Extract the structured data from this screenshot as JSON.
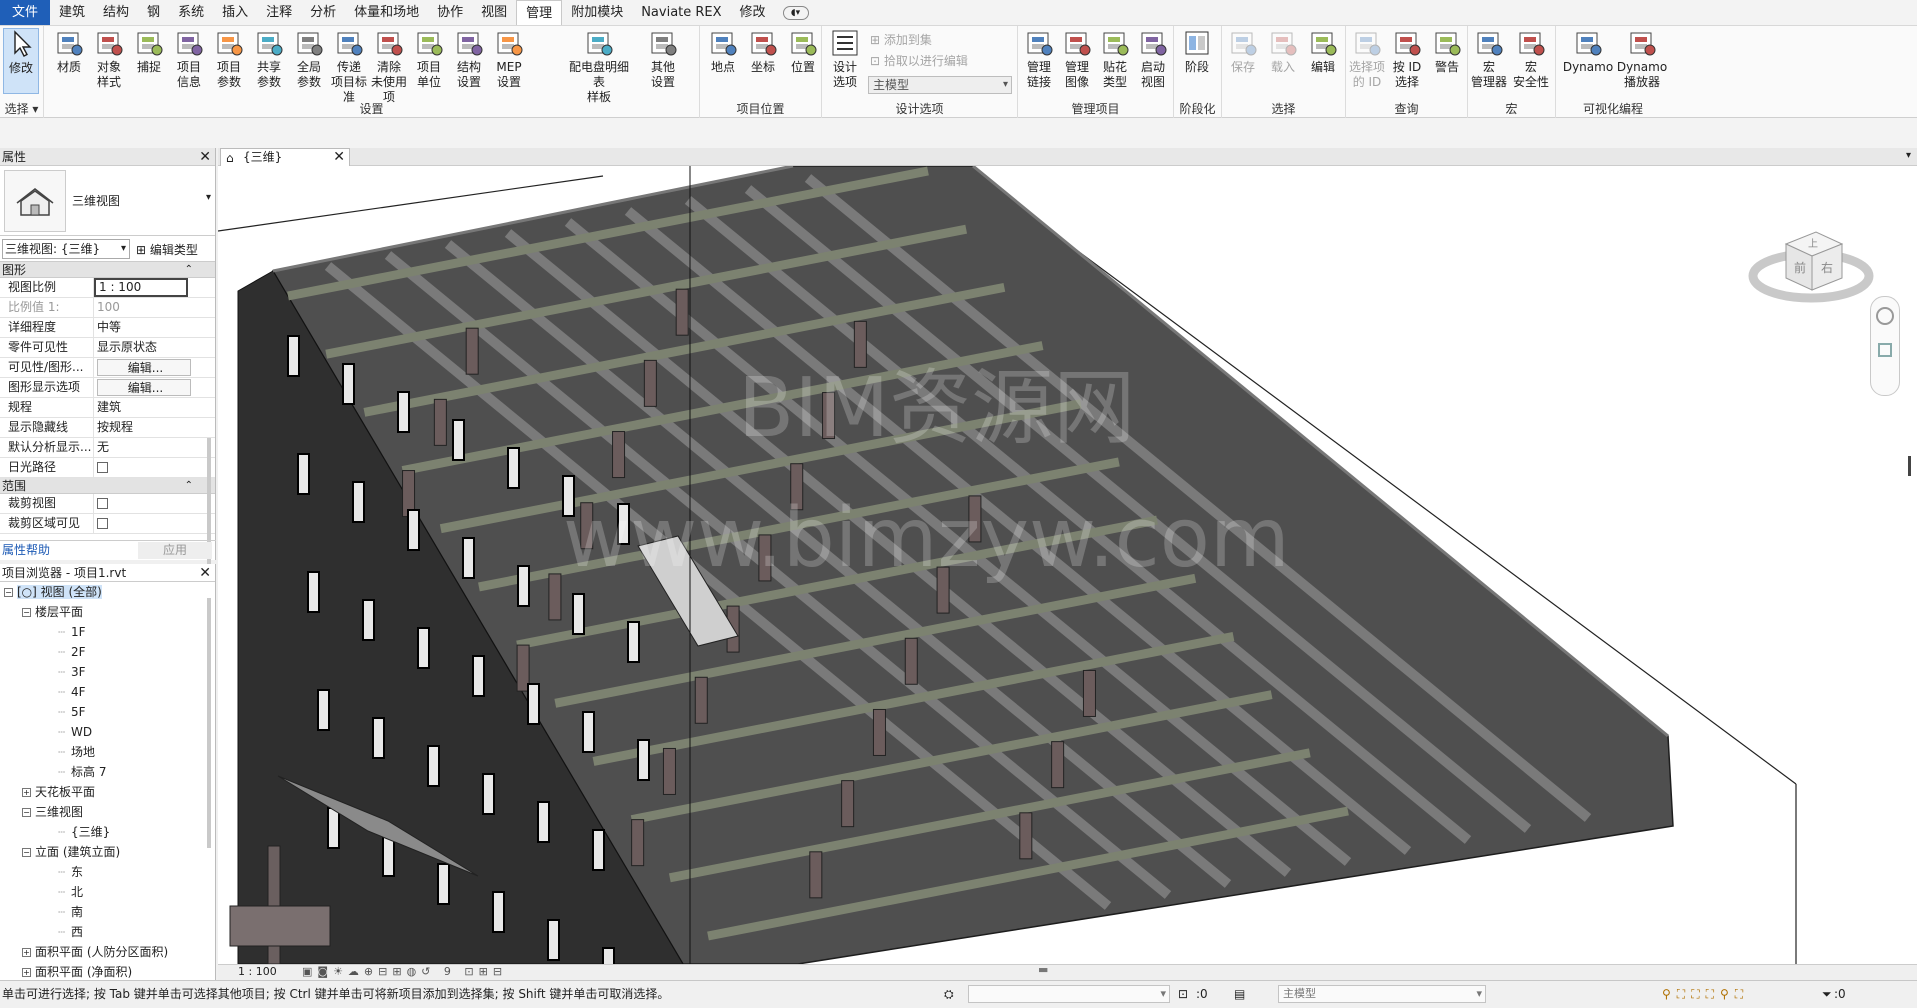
{
  "menu": {
    "tabs": [
      "文件",
      "建筑",
      "结构",
      "钢",
      "系统",
      "插入",
      "注释",
      "分析",
      "体量和场地",
      "协作",
      "视图",
      "管理",
      "附加模块",
      "Naviate REX",
      "修改"
    ],
    "active": "管理"
  },
  "ribbon": {
    "select": {
      "modify": "修改",
      "select": "选择 ▾"
    },
    "settings": {
      "title": "设置",
      "buttons": [
        {
          "l1": "材质",
          "l2": ""
        },
        {
          "l1": "对象",
          "l2": "样式"
        },
        {
          "l1": "捕捉",
          "l2": ""
        },
        {
          "l1": "项目",
          "l2": "信息"
        },
        {
          "l1": "项目",
          "l2": "参数"
        },
        {
          "l1": "共享",
          "l2": "参数"
        },
        {
          "l1": "全局",
          "l2": "参数"
        },
        {
          "l1": "传递",
          "l2": "项目标准"
        },
        {
          "l1": "清除",
          "l2": "未使用项"
        },
        {
          "l1": "项目",
          "l2": "单位"
        },
        {
          "l1": "结构",
          "l2": "设置"
        },
        {
          "l1": "MEP",
          "l2": "设置"
        },
        {
          "l1": "配电盘明细表",
          "l2": "样板"
        },
        {
          "l1": "其他",
          "l2": "设置"
        }
      ]
    },
    "location": {
      "title": "项目位置",
      "buttons": [
        {
          "l1": "地点",
          "l2": ""
        },
        {
          "l1": "坐标",
          "l2": ""
        },
        {
          "l1": "位置",
          "l2": ""
        }
      ]
    },
    "design_options": {
      "title": "设计选项",
      "button": {
        "l1": "设计",
        "l2": "选项"
      },
      "add_to_set": "添加到集",
      "pick_to_edit": "拾取以进行编辑",
      "main_model": "主模型"
    },
    "manage_project": {
      "title": "管理项目",
      "buttons": [
        {
          "l1": "管理",
          "l2": "链接"
        },
        {
          "l1": "管理",
          "l2": "图像"
        },
        {
          "l1": "贴花",
          "l2": "类型"
        },
        {
          "l1": "启动",
          "l2": "视图"
        }
      ]
    },
    "phasing": {
      "title": "阶段化",
      "button": "阶段"
    },
    "selection": {
      "title": "选择",
      "buttons": [
        "保存",
        "载入",
        "编辑"
      ]
    },
    "inquiry": {
      "title": "查询",
      "buttons": [
        {
          "l1": "选择项",
          "l2": "的 ID"
        },
        {
          "l1": "按 ID",
          "l2": "选择"
        },
        {
          "l1": "警告",
          "l2": ""
        }
      ]
    },
    "macros": {
      "title": "宏",
      "buttons": [
        {
          "l1": "宏",
          "l2": "管理器"
        },
        {
          "l1": "宏",
          "l2": "安全性"
        }
      ]
    },
    "visual_programming": {
      "title": "可视化编程",
      "buttons": [
        {
          "l1": "Dynamo",
          "l2": ""
        },
        {
          "l1": "Dynamo",
          "l2": "播放器"
        }
      ]
    }
  },
  "properties": {
    "title": "属性",
    "type_name": "三维视图",
    "instance_selector": "三维视图: {三维}",
    "edit_type": "编辑类型",
    "groups": [
      {
        "name": "图形",
        "rows": [
          {
            "k": "视图比例",
            "v": "1 : 100"
          },
          {
            "k": "比例值 1:",
            "v": "100"
          },
          {
            "k": "详细程度",
            "v": "中等"
          },
          {
            "k": "零件可见性",
            "v": "显示原状态"
          },
          {
            "k": "可见性/图形...",
            "v": "编辑..."
          },
          {
            "k": "图形显示选项",
            "v": "编辑..."
          },
          {
            "k": "规程",
            "v": "建筑"
          },
          {
            "k": "显示隐藏线",
            "v": "按规程"
          },
          {
            "k": "默认分析显示...",
            "v": "无"
          },
          {
            "k": "日光路径",
            "v": ""
          }
        ]
      },
      {
        "name": "范围",
        "rows": [
          {
            "k": "裁剪视图",
            "v": ""
          },
          {
            "k": "裁剪区域可见",
            "v": ""
          }
        ]
      }
    ],
    "help": "属性帮助",
    "apply": "应用"
  },
  "browser": {
    "title": "项目浏览器 - 项目1.rvt",
    "items": [
      {
        "label": "[○] 视图 (全部)",
        "lvl": 0,
        "tg": "−"
      },
      {
        "label": "楼层平面",
        "lvl": 1,
        "tg": "−"
      },
      {
        "label": "1F",
        "lvl": 3
      },
      {
        "label": "2F",
        "lvl": 3
      },
      {
        "label": "3F",
        "lvl": 3
      },
      {
        "label": "4F",
        "lvl": 3
      },
      {
        "label": "5F",
        "lvl": 3
      },
      {
        "label": "WD",
        "lvl": 3
      },
      {
        "label": "场地",
        "lvl": 3
      },
      {
        "label": "标高 7",
        "lvl": 3
      },
      {
        "label": "天花板平面",
        "lvl": 1,
        "tg": "+"
      },
      {
        "label": "三维视图",
        "lvl": 1,
        "tg": "−"
      },
      {
        "label": "{三维}",
        "lvl": 3
      },
      {
        "label": "立面 (建筑立面)",
        "lvl": 1,
        "tg": "−"
      },
      {
        "label": "东",
        "lvl": 3
      },
      {
        "label": "北",
        "lvl": 3
      },
      {
        "label": "南",
        "lvl": 3
      },
      {
        "label": "西",
        "lvl": 3
      },
      {
        "label": "面积平面 (人防分区面积)",
        "lvl": 1,
        "tg": "+"
      },
      {
        "label": "面积平面 (净面积)",
        "lvl": 1,
        "tg": "+"
      }
    ]
  },
  "view": {
    "tab_label": "{三维}",
    "watermark_line1": "BIM资源网",
    "watermark_line2": "www.bimzyw.com",
    "viewcube_top": "上",
    "viewcube_front": "前",
    "viewcube_right": "右",
    "scale": "1 : 100"
  },
  "status": {
    "text": "单击可进行选择; 按 Tab 键并单击可选择其他项目; 按 Ctrl 键并单击可将新项目添加到选择集; 按 Shift 键并单击可取消选择。",
    "count1": ":0",
    "model": "主模型",
    "count2": ":0"
  },
  "colors": {
    "accent": "#1f5fb8",
    "concrete": "#5d5d5d",
    "beam": "#7c8270",
    "wall_dark": "#2d2d2d"
  }
}
